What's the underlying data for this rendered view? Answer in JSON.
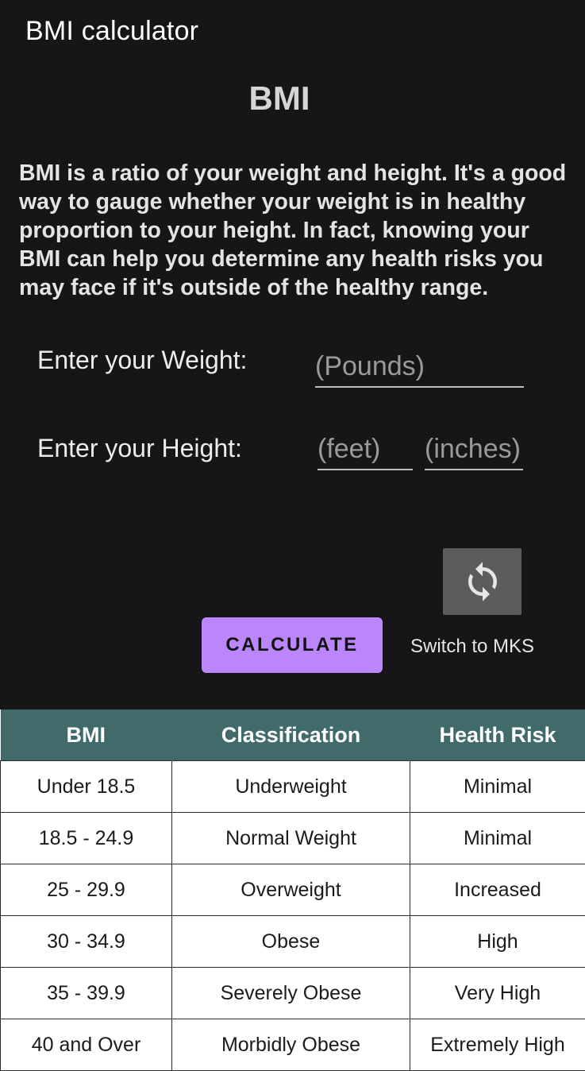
{
  "app_bar": {
    "title": "BMI calculator"
  },
  "main": {
    "heading": "BMI",
    "description": "BMI is a ratio of your weight and height. It's a good way to gauge whether your weight is in healthy proportion to your height. In fact, knowing your BMI can help you determine any health risks you may face if it's outside of the healthy range."
  },
  "form": {
    "weight_label": "Enter your Weight:",
    "weight_placeholder": "(Pounds)",
    "height_label": "Enter your Height:",
    "feet_placeholder": "(feet)",
    "inches_placeholder": "(inches)"
  },
  "actions": {
    "switch_icon": "refresh-icon",
    "calculate_label": "CALCULATE",
    "switch_label": "Switch to MKS"
  },
  "colors": {
    "background": "#161616",
    "accent": "#bb86fc",
    "table_header": "#416b6b",
    "switch_button": "#5c5c5c"
  },
  "table": {
    "headers": [
      "BMI",
      "Classification",
      "Health Risk"
    ],
    "rows": [
      [
        "Under 18.5",
        "Underweight",
        "Minimal"
      ],
      [
        "18.5 - 24.9",
        "Normal Weight",
        "Minimal"
      ],
      [
        "25 - 29.9",
        "Overweight",
        "Increased"
      ],
      [
        "30 - 34.9",
        "Obese",
        "High"
      ],
      [
        "35 - 39.9",
        "Severely Obese",
        "Very High"
      ],
      [
        "40 and Over",
        "Morbidly Obese",
        "Extremely High"
      ]
    ]
  }
}
